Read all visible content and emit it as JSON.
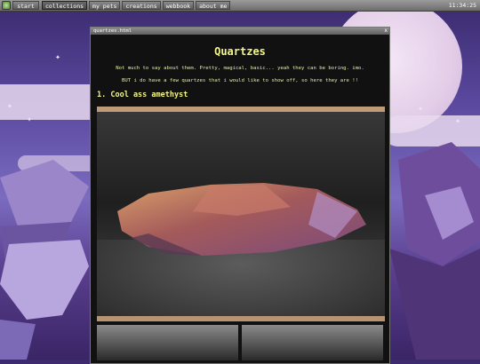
{
  "taskbar": {
    "logo_icon": "home-icon",
    "start_label": "start",
    "items": [
      {
        "label": "collections",
        "active": true
      },
      {
        "label": "my pets",
        "active": false
      },
      {
        "label": "creations",
        "active": false
      },
      {
        "label": "webbook",
        "active": false
      },
      {
        "label": "about me",
        "active": false
      }
    ],
    "clock": "11:34:25"
  },
  "window": {
    "title": "quartzes.html",
    "close_label": "x",
    "heading": "Quartzes",
    "paragraphs": [
      "Not much to say about them. Pretty, magical, basic... yeah they can be boring. imo.",
      "BUT i do have a few quartzes that i would like to show off, so here they are !!"
    ],
    "section_title": "1. Cool ass amethyst"
  },
  "colors": {
    "text_accent": "#f2f58a",
    "window_bg": "#111111",
    "taskbar_gray": "#7a7a7a"
  }
}
